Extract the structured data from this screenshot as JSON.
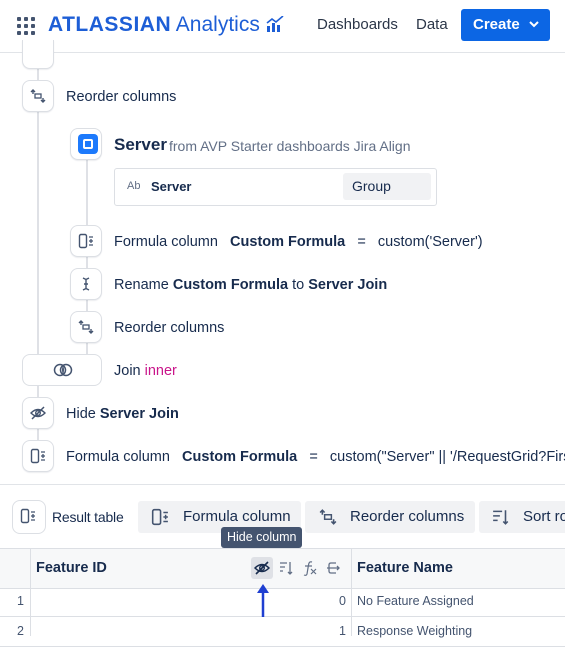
{
  "header": {
    "brand": "ATLASSIAN",
    "product": "Analytics",
    "nav": {
      "dashboards": "Dashboards",
      "data": "Data"
    },
    "create_label": "Create",
    "icons": [
      "app-switcher-icon",
      "analytics-chart-icon",
      "chevron-down-icon"
    ],
    "accent_color": "#0c66e4"
  },
  "flow": {
    "steps": {
      "reorder1": {
        "label": "Reorder columns"
      },
      "source": {
        "title": "Server",
        "from": "from AVP Starter dashboards Jira Align",
        "column": {
          "type": "Ab",
          "name": "Server",
          "aggregation": "Group"
        }
      },
      "formula1": {
        "prefix": "Formula column",
        "name": "Custom Formula",
        "eq": "=",
        "expr": "custom('Server')"
      },
      "rename": {
        "prefix": "Rename",
        "from": "Custom Formula",
        "to_word": "to",
        "to": "Server Join"
      },
      "reorder2": {
        "label": "Reorder columns"
      },
      "join": {
        "prefix": "Join",
        "type": "inner"
      },
      "hide": {
        "prefix": "Hide",
        "target": "Server Join"
      },
      "formula2": {
        "prefix": "Formula column",
        "name": "Custom Formula",
        "eq": "=",
        "expr": "custom(\"Server\" || '/RequestGrid?First"
      }
    }
  },
  "toolbar": {
    "result_label": "Result table",
    "formula_label": "Formula column",
    "reorder_label": "Reorder columns",
    "sort_label": "Sort ro"
  },
  "tooltip": "Hide column",
  "table": {
    "columns": [
      "Feature ID",
      "Feature Name"
    ],
    "rows": [
      {
        "num": "1",
        "feature_id": "0",
        "feature_name": "No Feature Assigned"
      },
      {
        "num": "2",
        "feature_id": "1",
        "feature_name": "Response Weighting"
      }
    ]
  }
}
